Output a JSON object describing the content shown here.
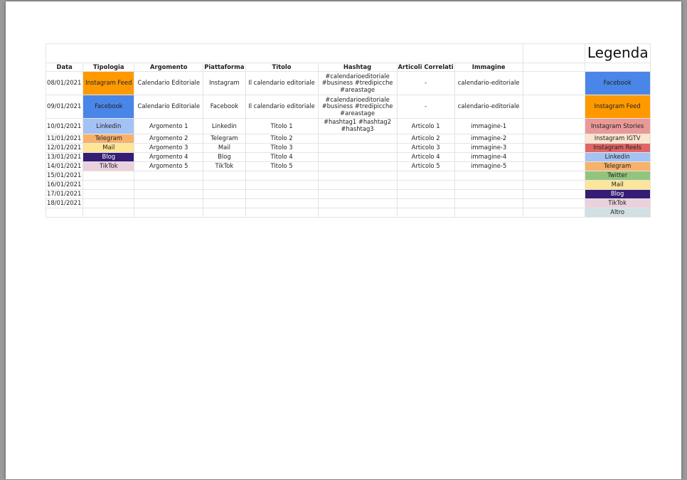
{
  "header": {
    "cols": [
      "Data",
      "Tipologia",
      "Argomento",
      "Piattaforma",
      "Titolo",
      "Hashtag",
      "Articoli Correlati",
      "Immagine"
    ],
    "legend_title": "Legenda"
  },
  "colors": {
    "instagram_feed": "#ff9900",
    "facebook": "#4a86e8",
    "linkedin": "#a4c2f4",
    "telegram": "#f6b26b",
    "mail": "#ffe599",
    "blog": "#351c75",
    "tiktok": "#ead1dc",
    "instagram_stories": "#ea9999",
    "instagram_igtv": "#fce5cd",
    "instagram_reels": "#e06666",
    "twitter": "#93c47d",
    "altro": "#d0e0e3"
  },
  "rows": [
    {
      "date": "08/01/2021",
      "tipologia": "Instagram Feed",
      "argomento": "Calendario Editoriale",
      "piattaforma": "Instagram",
      "titolo": "Il calendario editoriale",
      "hashtag": "#calendarioeditoriale #business #tredipicche #areastage",
      "articoli": "-",
      "immagine": "calendario-editoriale",
      "legend": "Facebook"
    },
    {
      "date": "09/01/2021",
      "tipologia": "Facebook",
      "argomento": "Calendario Editoriale",
      "piattaforma": "Facebook",
      "titolo": "Il calendario editoriale",
      "hashtag": "#calendarioeditoriale #business #tredipicche #areastage",
      "articoli": "-",
      "immagine": "calendario-editoriale",
      "legend": "Instagram Feed"
    },
    {
      "date": "10/01/2021",
      "tipologia": "Linkedin",
      "argomento": "Argomento 1",
      "piattaforma": "Linkedin",
      "titolo": "Titolo 1",
      "hashtag": "#hashtag1 #hashtag2 #hashtag3",
      "articoli": "Articolo 1",
      "immagine": "immagine-1",
      "legend": "Instagram Stories"
    },
    {
      "date": "11/01/2021",
      "tipologia": "Telegram",
      "argomento": "Argomento 2",
      "piattaforma": "Telegram",
      "titolo": "Titolo 2",
      "hashtag": "",
      "articoli": "Articolo 2",
      "immagine": "immagine-2",
      "legend": "Instagram IGTV"
    },
    {
      "date": "12/01/2021",
      "tipologia": "Mail",
      "argomento": "Argomento 3",
      "piattaforma": "Mail",
      "titolo": "Titolo 3",
      "hashtag": "",
      "articoli": "Articolo 3",
      "immagine": "immagine-3",
      "legend": "Instagram Reels"
    },
    {
      "date": "13/01/2021",
      "tipologia": "Blog",
      "argomento": "Argomento 4",
      "piattaforma": "Blog",
      "titolo": "Titolo 4",
      "hashtag": "",
      "articoli": "Articolo 4",
      "immagine": "immagine-4",
      "legend": "Linkedin"
    },
    {
      "date": "14/01/2021",
      "tipologia": "TikTok",
      "argomento": "Argomento 5",
      "piattaforma": "TikTok",
      "titolo": "Titolo 5",
      "hashtag": "",
      "articoli": "Articolo 5",
      "immagine": "immagine-5",
      "legend": "Telegram"
    },
    {
      "date": "15/01/2021",
      "legend": "Twitter"
    },
    {
      "date": "16/01/2021",
      "legend": "Mail"
    },
    {
      "date": "17/01/2021",
      "legend": "Blog"
    },
    {
      "date": "18/01/2021",
      "legend": "TikTok"
    },
    {
      "date": "",
      "legend": "Altro"
    }
  ]
}
